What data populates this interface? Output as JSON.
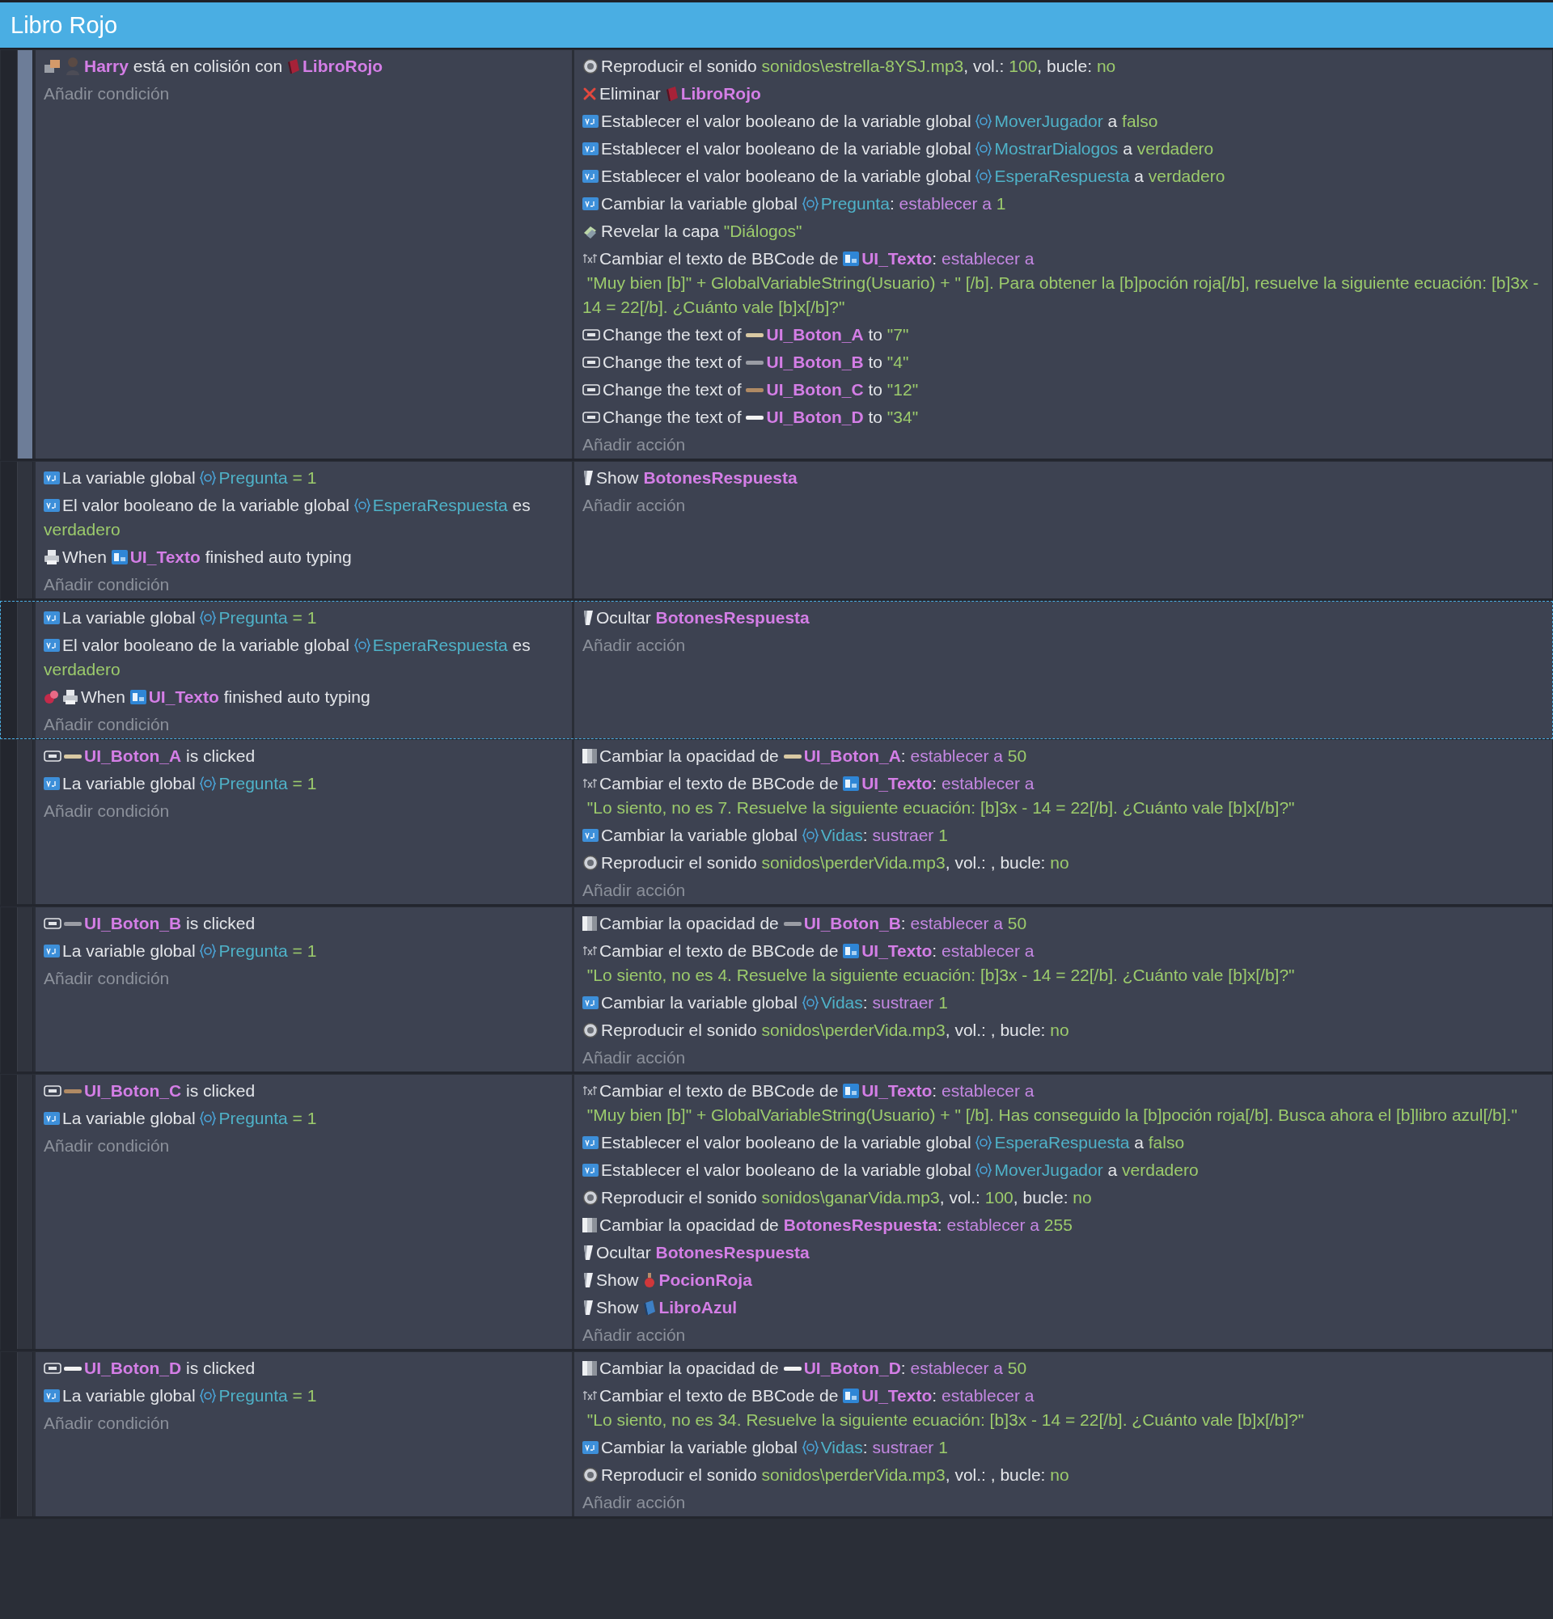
{
  "window": {
    "title": "Libro Rojo"
  },
  "events": [
    {
      "selected": false,
      "hovered": true,
      "add_condition": "Añadir condición",
      "add_action": "Añadir acción",
      "conditions": [
        [
          {
            "kind": "collision"
          },
          {
            "kind": "figure"
          },
          {
            "kind": "object",
            "text": "Harry"
          },
          {
            "kind": "text",
            "text": " está en colisión con "
          },
          {
            "kind": "redbook"
          },
          {
            "kind": "object",
            "text": "LibroRojo"
          }
        ]
      ],
      "actions": [
        [
          {
            "kind": "speaker"
          },
          {
            "kind": "text",
            "text": "Reproducir el sonido "
          },
          {
            "kind": "value",
            "text": "sonidos\\estrella-8YSJ.mp3"
          },
          {
            "kind": "text",
            "text": ", vol.: "
          },
          {
            "kind": "value",
            "text": "100"
          },
          {
            "kind": "text",
            "text": ", bucle: "
          },
          {
            "kind": "value",
            "text": "no"
          }
        ],
        [
          {
            "kind": "cross"
          },
          {
            "kind": "text",
            "text": "Eliminar "
          },
          {
            "kind": "redbook"
          },
          {
            "kind": "object",
            "text": "LibroRojo"
          }
        ],
        [
          {
            "kind": "vartag"
          },
          {
            "kind": "text",
            "text": "Establecer el valor booleano de la variable global "
          },
          {
            "kind": "braces"
          },
          {
            "kind": "variable",
            "text": "MoverJugador"
          },
          {
            "kind": "text",
            "text": " a "
          },
          {
            "kind": "value",
            "text": "falso"
          }
        ],
        [
          {
            "kind": "vartag"
          },
          {
            "kind": "text",
            "text": "Establecer el valor booleano de la variable global "
          },
          {
            "kind": "braces"
          },
          {
            "kind": "variable",
            "text": "MostrarDialogos"
          },
          {
            "kind": "text",
            "text": " a "
          },
          {
            "kind": "value",
            "text": "verdadero"
          }
        ],
        [
          {
            "kind": "vartag"
          },
          {
            "kind": "text",
            "text": "Establecer el valor booleano de la variable global "
          },
          {
            "kind": "braces"
          },
          {
            "kind": "variable",
            "text": "EsperaRespuesta"
          },
          {
            "kind": "text",
            "text": " a "
          },
          {
            "kind": "value",
            "text": "verdadero"
          }
        ],
        [
          {
            "kind": "vartag"
          },
          {
            "kind": "text",
            "text": "Cambiar la variable global "
          },
          {
            "kind": "braces"
          },
          {
            "kind": "variable",
            "text": "Pregunta"
          },
          {
            "kind": "text",
            "text": ": "
          },
          {
            "kind": "operation",
            "text": "establecer a"
          },
          {
            "kind": "value",
            "text": " 1"
          }
        ],
        [
          {
            "kind": "layer"
          },
          {
            "kind": "text",
            "text": "Revelar la capa "
          },
          {
            "kind": "value",
            "text": "\"Diálogos\""
          }
        ],
        [
          {
            "kind": "txt"
          },
          {
            "kind": "text",
            "text": "Cambiar el texto de BBCode de "
          },
          {
            "kind": "bbtext"
          },
          {
            "kind": "object",
            "text": "UI_Texto"
          },
          {
            "kind": "text",
            "text": ": "
          },
          {
            "kind": "operation",
            "text": "establecer a"
          },
          {
            "kind": "value",
            "text": " \"Muy bien [b]\" + GlobalVariableString(Usuario) + \" [/b]. Para obtener la [b]poción roja[/b], resuelve la siguiente ecuación: [b]3x - 14 = 22[/b]. ¿Cuánto vale [b]x[/b]?\""
          }
        ],
        [
          {
            "kind": "okbutton"
          },
          {
            "kind": "text",
            "text": "Change the text of "
          },
          {
            "kind": "bar",
            "color": "#d9c9a3"
          },
          {
            "kind": "object",
            "text": "UI_Boton_A"
          },
          {
            "kind": "text",
            "text": " to "
          },
          {
            "kind": "value",
            "text": "\"7\""
          }
        ],
        [
          {
            "kind": "okbutton"
          },
          {
            "kind": "text",
            "text": "Change the text of "
          },
          {
            "kind": "bar",
            "color": "#9a9ca4"
          },
          {
            "kind": "object",
            "text": "UI_Boton_B"
          },
          {
            "kind": "text",
            "text": " to "
          },
          {
            "kind": "value",
            "text": "\"4\""
          }
        ],
        [
          {
            "kind": "okbutton"
          },
          {
            "kind": "text",
            "text": "Change the text of "
          },
          {
            "kind": "bar",
            "color": "#b08a64"
          },
          {
            "kind": "object",
            "text": "UI_Boton_C"
          },
          {
            "kind": "text",
            "text": " to "
          },
          {
            "kind": "value",
            "text": "\"12\""
          }
        ],
        [
          {
            "kind": "okbutton"
          },
          {
            "kind": "text",
            "text": "Change the text of "
          },
          {
            "kind": "bar",
            "color": "#f2f2f2"
          },
          {
            "kind": "object",
            "text": "UI_Boton_D"
          },
          {
            "kind": "text",
            "text": " to "
          },
          {
            "kind": "value",
            "text": "\"34\""
          }
        ]
      ]
    },
    {
      "selected": false,
      "hovered": false,
      "add_condition": "Añadir condición",
      "add_action": "Añadir acción",
      "conditions": [
        [
          {
            "kind": "vartag"
          },
          {
            "kind": "text",
            "text": "La variable global "
          },
          {
            "kind": "braces"
          },
          {
            "kind": "variable",
            "text": "Pregunta"
          },
          {
            "kind": "value",
            "text": " = 1"
          }
        ],
        [
          {
            "kind": "vartag"
          },
          {
            "kind": "text",
            "text": "El valor booleano de la variable global "
          },
          {
            "kind": "braces"
          },
          {
            "kind": "variable",
            "text": "EsperaRespuesta"
          },
          {
            "kind": "text",
            "text": " es "
          },
          {
            "kind": "value",
            "text": "verdadero"
          }
        ],
        [
          {
            "kind": "printer"
          },
          {
            "kind": "text",
            "text": "When "
          },
          {
            "kind": "bbtext"
          },
          {
            "kind": "object",
            "text": "UI_Texto"
          },
          {
            "kind": "text",
            "text": " finished auto typing"
          }
        ]
      ],
      "actions": [
        [
          {
            "kind": "flag"
          },
          {
            "kind": "text",
            "text": "Show "
          },
          {
            "kind": "object",
            "text": "BotonesRespuesta"
          }
        ]
      ]
    },
    {
      "selected": true,
      "hovered": false,
      "add_condition": "Añadir condición",
      "add_action": "Añadir acción",
      "conditions": [
        [
          {
            "kind": "vartag"
          },
          {
            "kind": "text",
            "text": "La variable global "
          },
          {
            "kind": "braces"
          },
          {
            "kind": "variable",
            "text": "Pregunta"
          },
          {
            "kind": "value",
            "text": " = 1"
          }
        ],
        [
          {
            "kind": "vartag"
          },
          {
            "kind": "text",
            "text": "El valor booleano de la variable global "
          },
          {
            "kind": "braces"
          },
          {
            "kind": "variable",
            "text": "EsperaRespuesta"
          },
          {
            "kind": "text",
            "text": " es "
          },
          {
            "kind": "value",
            "text": "verdadero"
          }
        ],
        [
          {
            "kind": "invert"
          },
          {
            "kind": "printer"
          },
          {
            "kind": "text",
            "text": "When "
          },
          {
            "kind": "bbtext"
          },
          {
            "kind": "object",
            "text": "UI_Texto"
          },
          {
            "kind": "text",
            "text": " finished auto typing"
          }
        ]
      ],
      "actions": [
        [
          {
            "kind": "flag"
          },
          {
            "kind": "text",
            "text": "Ocultar "
          },
          {
            "kind": "object",
            "text": "BotonesRespuesta"
          }
        ]
      ]
    },
    {
      "selected": false,
      "hovered": false,
      "add_condition": "Añadir condición",
      "add_action": "Añadir acción",
      "conditions": [
        [
          {
            "kind": "okbutton"
          },
          {
            "kind": "bar",
            "color": "#d9c9a3"
          },
          {
            "kind": "object",
            "text": "UI_Boton_A"
          },
          {
            "kind": "text",
            "text": " is clicked"
          }
        ],
        [
          {
            "kind": "vartag"
          },
          {
            "kind": "text",
            "text": "La variable global "
          },
          {
            "kind": "braces"
          },
          {
            "kind": "variable",
            "text": "Pregunta"
          },
          {
            "kind": "value",
            "text": " = 1"
          }
        ]
      ],
      "actions": [
        [
          {
            "kind": "opacity"
          },
          {
            "kind": "text",
            "text": "Cambiar la opacidad de "
          },
          {
            "kind": "bar",
            "color": "#d9c9a3"
          },
          {
            "kind": "object",
            "text": "UI_Boton_A"
          },
          {
            "kind": "text",
            "text": ": "
          },
          {
            "kind": "operation",
            "text": "establecer a"
          },
          {
            "kind": "value",
            "text": " 50"
          }
        ],
        [
          {
            "kind": "txt"
          },
          {
            "kind": "text",
            "text": "Cambiar el texto de BBCode de "
          },
          {
            "kind": "bbtext"
          },
          {
            "kind": "object",
            "text": "UI_Texto"
          },
          {
            "kind": "text",
            "text": ": "
          },
          {
            "kind": "operation",
            "text": "establecer a"
          },
          {
            "kind": "value",
            "text": " \"Lo siento, no es 7. Resuelve la siguiente ecuación: [b]3x - 14 = 22[/b]. ¿Cuánto vale [b]x[/b]?\""
          }
        ],
        [
          {
            "kind": "vartag"
          },
          {
            "kind": "text",
            "text": "Cambiar la variable global "
          },
          {
            "kind": "braces"
          },
          {
            "kind": "variable",
            "text": "Vidas"
          },
          {
            "kind": "text",
            "text": ": "
          },
          {
            "kind": "operation",
            "text": "sustraer"
          },
          {
            "kind": "value",
            "text": " 1"
          }
        ],
        [
          {
            "kind": "speaker"
          },
          {
            "kind": "text",
            "text": "Reproducir el sonido "
          },
          {
            "kind": "value",
            "text": "sonidos\\perderVida.mp3"
          },
          {
            "kind": "text",
            "text": ", vol.: , bucle: "
          },
          {
            "kind": "value",
            "text": "no"
          }
        ]
      ]
    },
    {
      "selected": false,
      "hovered": false,
      "add_condition": "Añadir condición",
      "add_action": "Añadir acción",
      "conditions": [
        [
          {
            "kind": "okbutton"
          },
          {
            "kind": "bar",
            "color": "#9a9ca4"
          },
          {
            "kind": "object",
            "text": "UI_Boton_B"
          },
          {
            "kind": "text",
            "text": " is clicked"
          }
        ],
        [
          {
            "kind": "vartag"
          },
          {
            "kind": "text",
            "text": "La variable global "
          },
          {
            "kind": "braces"
          },
          {
            "kind": "variable",
            "text": "Pregunta"
          },
          {
            "kind": "value",
            "text": " = 1"
          }
        ]
      ],
      "actions": [
        [
          {
            "kind": "opacity"
          },
          {
            "kind": "text",
            "text": "Cambiar la opacidad de "
          },
          {
            "kind": "bar",
            "color": "#9a9ca4"
          },
          {
            "kind": "object",
            "text": "UI_Boton_B"
          },
          {
            "kind": "text",
            "text": ": "
          },
          {
            "kind": "operation",
            "text": "establecer a"
          },
          {
            "kind": "value",
            "text": " 50"
          }
        ],
        [
          {
            "kind": "txt"
          },
          {
            "kind": "text",
            "text": "Cambiar el texto de BBCode de "
          },
          {
            "kind": "bbtext"
          },
          {
            "kind": "object",
            "text": "UI_Texto"
          },
          {
            "kind": "text",
            "text": ": "
          },
          {
            "kind": "operation",
            "text": "establecer a"
          },
          {
            "kind": "value",
            "text": " \"Lo siento, no es 4. Resuelve la siguiente ecuación: [b]3x - 14 = 22[/b]. ¿Cuánto vale [b]x[/b]?\""
          }
        ],
        [
          {
            "kind": "vartag"
          },
          {
            "kind": "text",
            "text": "Cambiar la variable global "
          },
          {
            "kind": "braces"
          },
          {
            "kind": "variable",
            "text": "Vidas"
          },
          {
            "kind": "text",
            "text": ": "
          },
          {
            "kind": "operation",
            "text": "sustraer"
          },
          {
            "kind": "value",
            "text": " 1"
          }
        ],
        [
          {
            "kind": "speaker"
          },
          {
            "kind": "text",
            "text": "Reproducir el sonido "
          },
          {
            "kind": "value",
            "text": "sonidos\\perderVida.mp3"
          },
          {
            "kind": "text",
            "text": ", vol.: , bucle: "
          },
          {
            "kind": "value",
            "text": "no"
          }
        ]
      ]
    },
    {
      "selected": false,
      "hovered": false,
      "add_condition": "Añadir condición",
      "add_action": "Añadir acción",
      "conditions": [
        [
          {
            "kind": "okbutton"
          },
          {
            "kind": "bar",
            "color": "#b08a64"
          },
          {
            "kind": "object",
            "text": "UI_Boton_C"
          },
          {
            "kind": "text",
            "text": " is clicked"
          }
        ],
        [
          {
            "kind": "vartag"
          },
          {
            "kind": "text",
            "text": "La variable global "
          },
          {
            "kind": "braces"
          },
          {
            "kind": "variable",
            "text": "Pregunta"
          },
          {
            "kind": "value",
            "text": " = 1"
          }
        ]
      ],
      "actions": [
        [
          {
            "kind": "txt"
          },
          {
            "kind": "text",
            "text": "Cambiar el texto de BBCode de "
          },
          {
            "kind": "bbtext"
          },
          {
            "kind": "object",
            "text": "UI_Texto"
          },
          {
            "kind": "text",
            "text": ": "
          },
          {
            "kind": "operation",
            "text": "establecer a"
          },
          {
            "kind": "value",
            "text": " \"Muy bien [b]\" + GlobalVariableString(Usuario) + \" [/b]. Has conseguido la [b]poción roja[/b]. Busca ahora el [b]libro azul[/b].\""
          }
        ],
        [
          {
            "kind": "vartag"
          },
          {
            "kind": "text",
            "text": "Establecer el valor booleano de la variable global "
          },
          {
            "kind": "braces"
          },
          {
            "kind": "variable",
            "text": "EsperaRespuesta"
          },
          {
            "kind": "text",
            "text": " a "
          },
          {
            "kind": "value",
            "text": "falso"
          }
        ],
        [
          {
            "kind": "vartag"
          },
          {
            "kind": "text",
            "text": "Establecer el valor booleano de la variable global "
          },
          {
            "kind": "braces"
          },
          {
            "kind": "variable",
            "text": "MoverJugador"
          },
          {
            "kind": "text",
            "text": " a "
          },
          {
            "kind": "value",
            "text": "verdadero"
          }
        ],
        [
          {
            "kind": "speaker"
          },
          {
            "kind": "text",
            "text": "Reproducir el sonido "
          },
          {
            "kind": "value",
            "text": "sonidos\\ganarVida.mp3"
          },
          {
            "kind": "text",
            "text": ", vol.: "
          },
          {
            "kind": "value",
            "text": "100"
          },
          {
            "kind": "text",
            "text": ", bucle: "
          },
          {
            "kind": "value",
            "text": "no"
          }
        ],
        [
          {
            "kind": "opacity"
          },
          {
            "kind": "text",
            "text": "Cambiar la opacidad de "
          },
          {
            "kind": "object",
            "text": "BotonesRespuesta"
          },
          {
            "kind": "text",
            "text": ": "
          },
          {
            "kind": "operation",
            "text": "establecer a"
          },
          {
            "kind": "value",
            "text": " 255"
          }
        ],
        [
          {
            "kind": "flag"
          },
          {
            "kind": "text",
            "text": "Ocultar "
          },
          {
            "kind": "object",
            "text": "BotonesRespuesta"
          }
        ],
        [
          {
            "kind": "flag"
          },
          {
            "kind": "text",
            "text": "Show "
          },
          {
            "kind": "potion"
          },
          {
            "kind": "object",
            "text": "PocionRoja"
          }
        ],
        [
          {
            "kind": "flag"
          },
          {
            "kind": "text",
            "text": "Show "
          },
          {
            "kind": "bluebook"
          },
          {
            "kind": "object",
            "text": "LibroAzul"
          }
        ]
      ]
    },
    {
      "selected": false,
      "hovered": false,
      "add_condition": "Añadir condición",
      "add_action": "Añadir acción",
      "conditions": [
        [
          {
            "kind": "okbutton"
          },
          {
            "kind": "bar",
            "color": "#f2f2f2"
          },
          {
            "kind": "object",
            "text": "UI_Boton_D"
          },
          {
            "kind": "text",
            "text": " is clicked"
          }
        ],
        [
          {
            "kind": "vartag"
          },
          {
            "kind": "text",
            "text": "La variable global "
          },
          {
            "kind": "braces"
          },
          {
            "kind": "variable",
            "text": "Pregunta"
          },
          {
            "kind": "value",
            "text": " = 1"
          }
        ]
      ],
      "actions": [
        [
          {
            "kind": "opacity"
          },
          {
            "kind": "text",
            "text": "Cambiar la opacidad de "
          },
          {
            "kind": "bar",
            "color": "#f2f2f2"
          },
          {
            "kind": "object",
            "text": "UI_Boton_D"
          },
          {
            "kind": "text",
            "text": ": "
          },
          {
            "kind": "operation",
            "text": "establecer a"
          },
          {
            "kind": "value",
            "text": " 50"
          }
        ],
        [
          {
            "kind": "txt"
          },
          {
            "kind": "text",
            "text": "Cambiar el texto de BBCode de "
          },
          {
            "kind": "bbtext"
          },
          {
            "kind": "object",
            "text": "UI_Texto"
          },
          {
            "kind": "text",
            "text": ": "
          },
          {
            "kind": "operation",
            "text": "establecer a"
          },
          {
            "kind": "value",
            "text": " \"Lo siento, no es 34. Resuelve la siguiente ecuación: [b]3x - 14 = 22[/b]. ¿Cuánto vale [b]x[/b]?\""
          }
        ],
        [
          {
            "kind": "vartag"
          },
          {
            "kind": "text",
            "text": "Cambiar la variable global "
          },
          {
            "kind": "braces"
          },
          {
            "kind": "variable",
            "text": "Vidas"
          },
          {
            "kind": "text",
            "text": ": "
          },
          {
            "kind": "operation",
            "text": "sustraer"
          },
          {
            "kind": "value",
            "text": " 1"
          }
        ],
        [
          {
            "kind": "speaker"
          },
          {
            "kind": "text",
            "text": "Reproducir el sonido "
          },
          {
            "kind": "value",
            "text": "sonidos\\perderVida.mp3"
          },
          {
            "kind": "text",
            "text": ", vol.: , bucle: "
          },
          {
            "kind": "value",
            "text": "no"
          }
        ]
      ]
    }
  ]
}
